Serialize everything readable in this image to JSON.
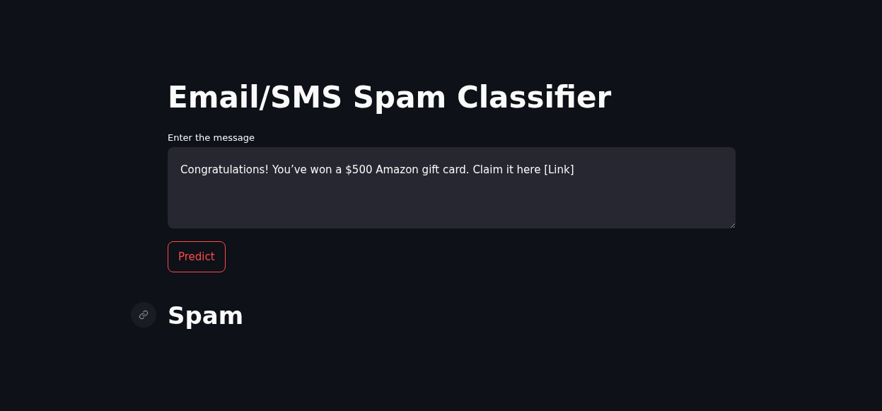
{
  "title": "Email/SMS Spam Classifier",
  "message_field": {
    "label": "Enter the message",
    "value": "Congratulations! You’ve won a $500 Amazon gift card. Claim it here [Link]"
  },
  "predict_button": {
    "label": "Predict"
  },
  "result": {
    "text": "Spam"
  }
}
